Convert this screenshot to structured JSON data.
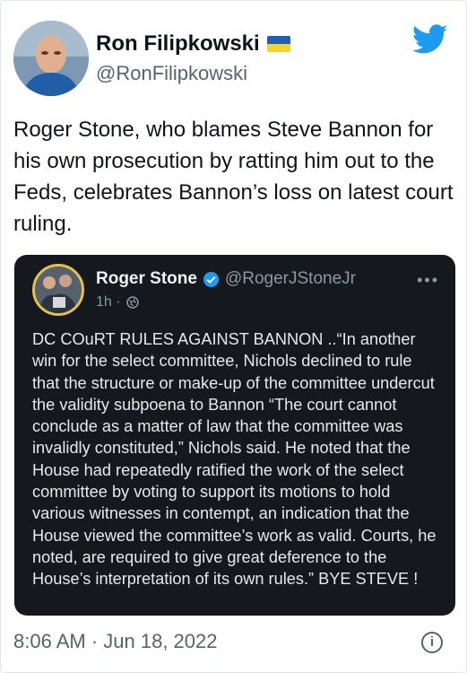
{
  "author": {
    "display_name": "Ron Filipkowski",
    "handle": "@RonFilipkowski",
    "flag_icon": "ukraine-flag-icon"
  },
  "tweet": {
    "text": "Roger Stone, who blames Steve Bannon for his own prosecution by ratting him out to the Feds, celebrates Bannon’s loss on latest court ruling."
  },
  "quoted": {
    "display_name": "Roger Stone",
    "handle": "@RogerJStoneJr",
    "time": "1h ·",
    "more": "•••",
    "body": "DC COuRT RULES AGAINST BANNON ..“In another win for the select committee, Nichols declined to rule that the structure or make-up of the committee undercut the validity subpoena to Bannon “The court cannot conclude as a matter of law that the committee was invalidly constituted,” Nichols said. He noted that the House had repeatedly ratified the work of the select committee by voting to support its motions to hold various witnesses in contempt, an indication that the House viewed the committee’s work as valid. Courts, he noted, are required to give great deference to the House’s interpretation of its own rules.” BYE STEVE !"
  },
  "footer": {
    "timestamp": "8:06 AM · Jun 18, 2022",
    "info_glyph": "i"
  },
  "colors": {
    "twitter_blue": "#1d9bf0",
    "quote_bg": "#15181c",
    "muted": "#536471"
  }
}
